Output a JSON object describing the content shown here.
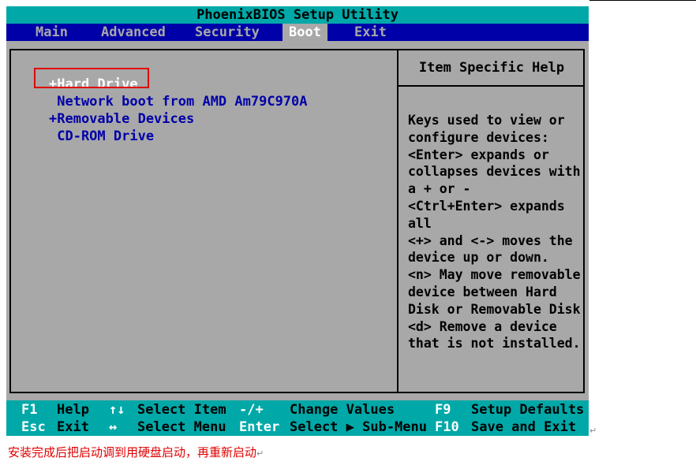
{
  "title": "PhoenixBIOS Setup Utility",
  "menu": [
    {
      "label": "Main",
      "active": false
    },
    {
      "label": "Advanced",
      "active": false
    },
    {
      "label": "Security",
      "active": false
    },
    {
      "label": "Boot",
      "active": true
    },
    {
      "label": "Exit",
      "active": false
    }
  ],
  "boot_items": [
    {
      "label": "+Hard Drive",
      "selected": true
    },
    {
      "label": " Network boot from AMD Am79C970A",
      "selected": false
    },
    {
      "label": "+Removable Devices",
      "selected": false
    },
    {
      "label": " CD-ROM Drive",
      "selected": false
    }
  ],
  "help": {
    "title": "Item Specific Help",
    "lines": [
      "Keys used to view or",
      "configure devices:",
      "<Enter> expands or",
      "collapses devices with",
      "a + or -",
      "<Ctrl+Enter> expands",
      "all",
      "<+> and <-> moves the",
      "device up or down.",
      "<n> May move removable",
      "device between Hard",
      "Disk or Removable Disk",
      "<d> Remove a device",
      "that is not installed."
    ]
  },
  "footer": {
    "row1": [
      {
        "key": "F1",
        "label": "Help"
      },
      {
        "key": "↑↓",
        "label": "Select Item"
      },
      {
        "key": "-/+",
        "label": "Change Values"
      },
      {
        "key": "F9",
        "label": "Setup Defaults"
      }
    ],
    "row2": [
      {
        "key": "Esc",
        "label": "Exit"
      },
      {
        "key": "↔",
        "label": "Select Menu"
      },
      {
        "key": "Enter",
        "label": "Select ▶ Sub-Menu"
      },
      {
        "key": "F10",
        "label": "Save and Exit"
      }
    ]
  },
  "caption": "安装完成后把启动调到用硬盘启动，再重新启动",
  "paragraph_mark": "↵",
  "colors": {
    "bios_gray": "#a8a8a8",
    "title_teal": "#00a8a8",
    "menu_blue": "#0000a8",
    "item_blue": "#0000a8",
    "highlight_red": "#e00000"
  }
}
